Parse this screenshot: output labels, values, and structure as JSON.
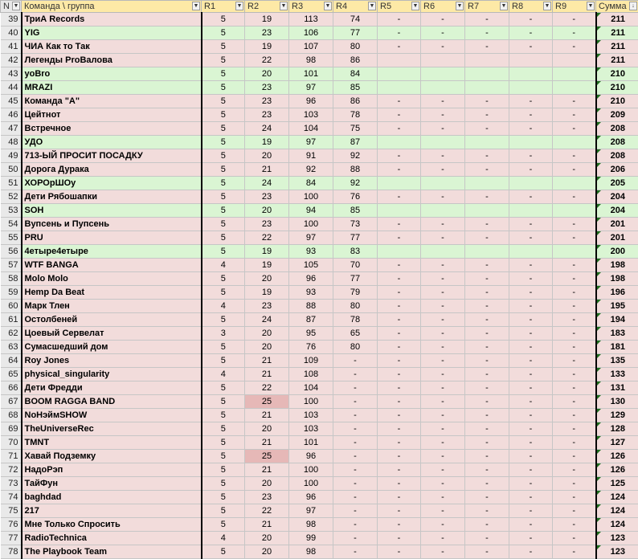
{
  "header": {
    "row_label": "N",
    "team_label": "Команда \\ группа",
    "rounds": [
      "R1",
      "R2",
      "R3",
      "R4",
      "R5",
      "R6",
      "R7",
      "R8",
      "R9"
    ],
    "sum_label": "Сумма"
  },
  "rows": [
    {
      "n": "39",
      "team": "ТриА Records",
      "r": [
        "5",
        "19",
        "113",
        "74",
        "-",
        "-",
        "-",
        "-",
        "-"
      ],
      "sum": "211",
      "color": "pink"
    },
    {
      "n": "40",
      "team": "YIG",
      "r": [
        "5",
        "23",
        "106",
        "77",
        "-",
        "-",
        "-",
        "-",
        "-"
      ],
      "sum": "211",
      "color": "green"
    },
    {
      "n": "41",
      "team": "ЧИА Как то Так",
      "r": [
        "5",
        "19",
        "107",
        "80",
        "-",
        "-",
        "-",
        "-",
        "-"
      ],
      "sum": "211",
      "color": "pink"
    },
    {
      "n": "42",
      "team": "Легенды ProВалова",
      "r": [
        "5",
        "22",
        "98",
        "86",
        "",
        "",
        "",
        "",
        ""
      ],
      "sum": "211",
      "color": "pink"
    },
    {
      "n": "43",
      "team": "yoBro",
      "r": [
        "5",
        "20",
        "101",
        "84",
        "",
        "",
        "",
        "",
        ""
      ],
      "sum": "210",
      "color": "green"
    },
    {
      "n": "44",
      "team": "MRAZI",
      "r": [
        "5",
        "23",
        "97",
        "85",
        "",
        "",
        "",
        "",
        ""
      ],
      "sum": "210",
      "color": "green"
    },
    {
      "n": "45",
      "team": "Команда \"А\"",
      "r": [
        "5",
        "23",
        "96",
        "86",
        "-",
        "-",
        "-",
        "-",
        "-"
      ],
      "sum": "210",
      "color": "pink"
    },
    {
      "n": "46",
      "team": "Цейтнот",
      "r": [
        "5",
        "23",
        "103",
        "78",
        "-",
        "-",
        "-",
        "-",
        "-"
      ],
      "sum": "209",
      "color": "pink"
    },
    {
      "n": "47",
      "team": "Встречное",
      "r": [
        "5",
        "24",
        "104",
        "75",
        "-",
        "-",
        "-",
        "-",
        "-"
      ],
      "sum": "208",
      "color": "pink"
    },
    {
      "n": "48",
      "team": "УДО",
      "r": [
        "5",
        "19",
        "97",
        "87",
        "",
        "",
        "",
        "",
        ""
      ],
      "sum": "208",
      "color": "green"
    },
    {
      "n": "49",
      "team": "713-ЫЙ ПРОСИТ ПОСАДКУ",
      "r": [
        "5",
        "20",
        "91",
        "92",
        "-",
        "-",
        "-",
        "-",
        "-"
      ],
      "sum": "208",
      "color": "pink"
    },
    {
      "n": "50",
      "team": "Дорога Дурака",
      "r": [
        "5",
        "21",
        "92",
        "88",
        "-",
        "-",
        "-",
        "-",
        "-"
      ],
      "sum": "206",
      "color": "pink"
    },
    {
      "n": "51",
      "team": "ХОРОрШОу",
      "r": [
        "5",
        "24",
        "84",
        "92",
        "",
        "",
        "",
        "",
        ""
      ],
      "sum": "205",
      "color": "green"
    },
    {
      "n": "52",
      "team": "Дети Рябошапки",
      "r": [
        "5",
        "23",
        "100",
        "76",
        "-",
        "-",
        "-",
        "-",
        "-"
      ],
      "sum": "204",
      "color": "pink"
    },
    {
      "n": "53",
      "team": "SOH",
      "r": [
        "5",
        "20",
        "94",
        "85",
        "",
        "",
        "",
        "",
        ""
      ],
      "sum": "204",
      "color": "green"
    },
    {
      "n": "54",
      "team": "Вупсень и Пупсень",
      "r": [
        "5",
        "23",
        "100",
        "73",
        "-",
        "-",
        "-",
        "-",
        "-"
      ],
      "sum": "201",
      "color": "pink"
    },
    {
      "n": "55",
      "team": "PRU",
      "r": [
        "5",
        "22",
        "97",
        "77",
        "-",
        "-",
        "-",
        "-",
        "-"
      ],
      "sum": "201",
      "color": "pink"
    },
    {
      "n": "56",
      "team": "4етыре4етыре",
      "r": [
        "5",
        "19",
        "93",
        "83",
        "",
        "",
        "",
        "",
        ""
      ],
      "sum": "200",
      "color": "green"
    },
    {
      "n": "57",
      "team": "WTF BANGA",
      "r": [
        "4",
        "19",
        "105",
        "70",
        "-",
        "-",
        "-",
        "-",
        "-"
      ],
      "sum": "198",
      "color": "pink"
    },
    {
      "n": "58",
      "team": "Molo Molo",
      "r": [
        "5",
        "20",
        "96",
        "77",
        "-",
        "-",
        "-",
        "-",
        "-"
      ],
      "sum": "198",
      "color": "pink"
    },
    {
      "n": "59",
      "team": "Hemp Da Beat",
      "r": [
        "5",
        "19",
        "93",
        "79",
        "-",
        "-",
        "-",
        "-",
        "-"
      ],
      "sum": "196",
      "color": "pink"
    },
    {
      "n": "60",
      "team": "Марк Тлен",
      "r": [
        "4",
        "23",
        "88",
        "80",
        "-",
        "-",
        "-",
        "-",
        "-"
      ],
      "sum": "195",
      "color": "pink"
    },
    {
      "n": "61",
      "team": "Остолбеней",
      "r": [
        "5",
        "24",
        "87",
        "78",
        "-",
        "-",
        "-",
        "-",
        "-"
      ],
      "sum": "194",
      "color": "pink"
    },
    {
      "n": "62",
      "team": "Цоевый Сервелат",
      "r": [
        "3",
        "20",
        "95",
        "65",
        "-",
        "-",
        "-",
        "-",
        "-"
      ],
      "sum": "183",
      "color": "pink"
    },
    {
      "n": "63",
      "team": "Сумасшедший дом",
      "r": [
        "5",
        "20",
        "76",
        "80",
        "-",
        "-",
        "-",
        "-",
        "-"
      ],
      "sum": "181",
      "color": "pink"
    },
    {
      "n": "64",
      "team": "Roy Jones",
      "r": [
        "5",
        "21",
        "109",
        "-",
        "-",
        "-",
        "-",
        "-",
        "-"
      ],
      "sum": "135",
      "color": "pink"
    },
    {
      "n": "65",
      "team": "physical_singularity",
      "r": [
        "4",
        "21",
        "108",
        "-",
        "-",
        "-",
        "-",
        "-",
        "-"
      ],
      "sum": "133",
      "color": "pink"
    },
    {
      "n": "66",
      "team": "Дети Фредди",
      "r": [
        "5",
        "22",
        "104",
        "-",
        "-",
        "-",
        "-",
        "-",
        "-"
      ],
      "sum": "131",
      "color": "pink"
    },
    {
      "n": "67",
      "team": "BOOM RAGGA BAND",
      "r": [
        "5",
        "25",
        "100",
        "-",
        "-",
        "-",
        "-",
        "-",
        "-"
      ],
      "sum": "130",
      "color": "pink",
      "hl": 1
    },
    {
      "n": "68",
      "team": "NoНэймSHOW",
      "r": [
        "5",
        "21",
        "103",
        "-",
        "-",
        "-",
        "-",
        "-",
        "-"
      ],
      "sum": "129",
      "color": "pink"
    },
    {
      "n": "69",
      "team": "TheUniverseRec",
      "r": [
        "5",
        "20",
        "103",
        "-",
        "-",
        "-",
        "-",
        "-",
        "-"
      ],
      "sum": "128",
      "color": "pink"
    },
    {
      "n": "70",
      "team": "TMNT",
      "r": [
        "5",
        "21",
        "101",
        "-",
        "-",
        "-",
        "-",
        "-",
        "-"
      ],
      "sum": "127",
      "color": "pink"
    },
    {
      "n": "71",
      "team": "Хавай Подземку",
      "r": [
        "5",
        "25",
        "96",
        "-",
        "-",
        "-",
        "-",
        "-",
        "-"
      ],
      "sum": "126",
      "color": "pink",
      "hl": 1
    },
    {
      "n": "72",
      "team": "НадоРэп",
      "r": [
        "5",
        "21",
        "100",
        "-",
        "-",
        "-",
        "-",
        "-",
        "-"
      ],
      "sum": "126",
      "color": "pink"
    },
    {
      "n": "73",
      "team": "ТайФун",
      "r": [
        "5",
        "20",
        "100",
        "-",
        "-",
        "-",
        "-",
        "-",
        "-"
      ],
      "sum": "125",
      "color": "pink"
    },
    {
      "n": "74",
      "team": "baghdad",
      "r": [
        "5",
        "23",
        "96",
        "-",
        "-",
        "-",
        "-",
        "-",
        "-"
      ],
      "sum": "124",
      "color": "pink"
    },
    {
      "n": "75",
      "team": "217",
      "r": [
        "5",
        "22",
        "97",
        "-",
        "-",
        "-",
        "-",
        "-",
        "-"
      ],
      "sum": "124",
      "color": "pink"
    },
    {
      "n": "76",
      "team": "Мне Только Спросить",
      "r": [
        "5",
        "21",
        "98",
        "-",
        "-",
        "-",
        "-",
        "-",
        "-"
      ],
      "sum": "124",
      "color": "pink"
    },
    {
      "n": "77",
      "team": "RadioTechnica",
      "r": [
        "4",
        "20",
        "99",
        "-",
        "-",
        "-",
        "-",
        "-",
        "-"
      ],
      "sum": "123",
      "color": "pink"
    },
    {
      "n": "78",
      "team": "The Playbook Team",
      "r": [
        "5",
        "20",
        "98",
        "-",
        "-",
        "-",
        "-",
        "-",
        "-"
      ],
      "sum": "123",
      "color": "pink"
    }
  ]
}
